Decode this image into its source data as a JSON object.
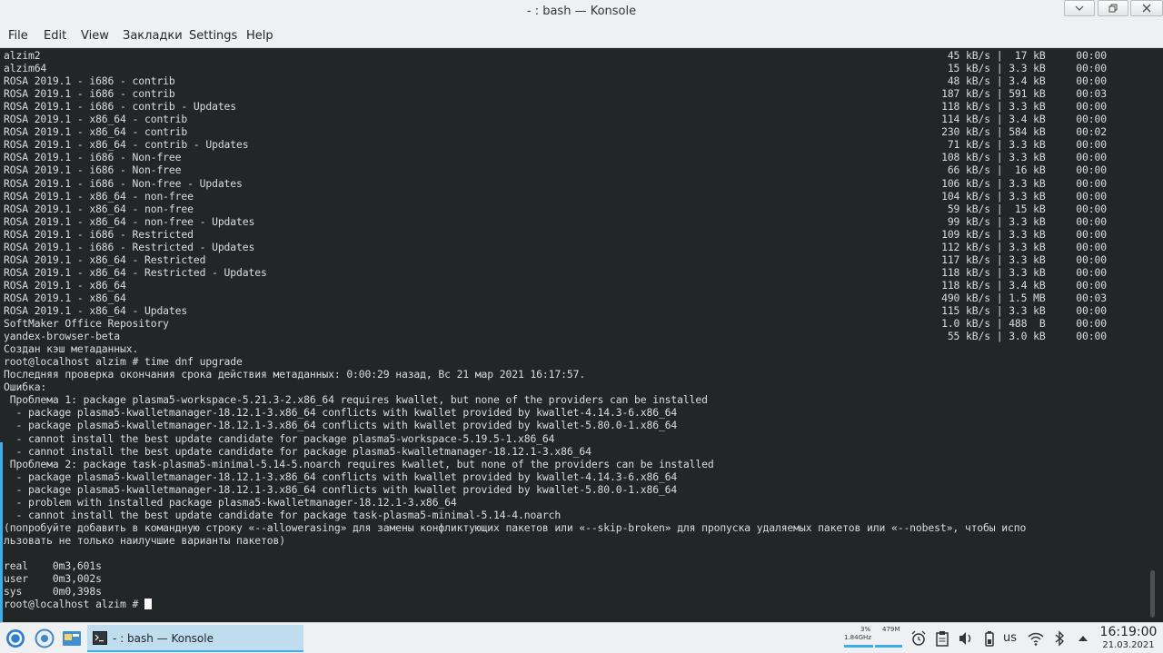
{
  "window": {
    "title": "- : bash — Konsole"
  },
  "menu": [
    "File",
    "Edit",
    "View",
    "Закладки",
    "Settings",
    "Help"
  ],
  "repo_lines": [
    {
      "name": "alzim2",
      "stats": "45 kB/s |  17 kB     00:00"
    },
    {
      "name": "alzim64",
      "stats": "15 kB/s | 3.3 kB     00:00"
    },
    {
      "name": "ROSA 2019.1 - i686 - contrib",
      "stats": "48 kB/s | 3.4 kB     00:00"
    },
    {
      "name": "ROSA 2019.1 - i686 - contrib",
      "stats": "187 kB/s | 591 kB     00:03"
    },
    {
      "name": "ROSA 2019.1 - i686 - contrib - Updates",
      "stats": "118 kB/s | 3.3 kB     00:00"
    },
    {
      "name": "ROSA 2019.1 - x86_64 - contrib",
      "stats": "114 kB/s | 3.4 kB     00:00"
    },
    {
      "name": "ROSA 2019.1 - x86_64 - contrib",
      "stats": "230 kB/s | 584 kB     00:02"
    },
    {
      "name": "ROSA 2019.1 - x86_64 - contrib - Updates",
      "stats": "71 kB/s | 3.3 kB     00:00"
    },
    {
      "name": "ROSA 2019.1 - i686 - Non-free",
      "stats": "108 kB/s | 3.3 kB     00:00"
    },
    {
      "name": "ROSA 2019.1 - i686 - Non-free",
      "stats": "66 kB/s |  16 kB     00:00"
    },
    {
      "name": "ROSA 2019.1 - i686 - Non-free - Updates",
      "stats": "106 kB/s | 3.3 kB     00:00"
    },
    {
      "name": "ROSA 2019.1 - x86_64 - non-free",
      "stats": "104 kB/s | 3.3 kB     00:00"
    },
    {
      "name": "ROSA 2019.1 - x86_64 - non-free",
      "stats": "59 kB/s |  15 kB     00:00"
    },
    {
      "name": "ROSA 2019.1 - x86_64 - non-free - Updates",
      "stats": "99 kB/s | 3.3 kB     00:00"
    },
    {
      "name": "ROSA 2019.1 - i686 - Restricted",
      "stats": "109 kB/s | 3.3 kB     00:00"
    },
    {
      "name": "ROSA 2019.1 - i686 - Restricted - Updates",
      "stats": "112 kB/s | 3.3 kB     00:00"
    },
    {
      "name": "ROSA 2019.1 - x86_64 - Restricted",
      "stats": "117 kB/s | 3.3 kB     00:00"
    },
    {
      "name": "ROSA 2019.1 - x86_64 - Restricted - Updates",
      "stats": "118 kB/s | 3.3 kB     00:00"
    },
    {
      "name": "ROSA 2019.1 - x86_64",
      "stats": "118 kB/s | 3.4 kB     00:00"
    },
    {
      "name": "ROSA 2019.1 - x86_64",
      "stats": "490 kB/s | 1.5 MB     00:03"
    },
    {
      "name": "ROSA 2019.1 - x86_64 - Updates",
      "stats": "115 kB/s | 3.3 kB     00:00"
    },
    {
      "name": "SoftMaker Office Repository",
      "stats": "1.0 kB/s | 488  B     00:00"
    },
    {
      "name": "yandex-browser-beta",
      "stats": "55 kB/s | 3.0 kB     00:00"
    }
  ],
  "output_lines": [
    "Создан кэш метаданных.",
    "root@localhost alzim # time dnf upgrade",
    "Последняя проверка окончания срока действия метаданных: 0:00:29 назад, Вс 21 мар 2021 16:17:57.",
    "Ошибка:",
    " Проблема 1: package plasma5-workspace-5.21.3-2.x86_64 requires kwallet, but none of the providers can be installed",
    "  - package plasma5-kwalletmanager-18.12.1-3.x86_64 conflicts with kwallet provided by kwallet-4.14.3-6.x86_64",
    "  - package plasma5-kwalletmanager-18.12.1-3.x86_64 conflicts with kwallet provided by kwallet-5.80.0-1.x86_64",
    "  - cannot install the best update candidate for package plasma5-workspace-5.19.5-1.x86_64",
    "  - cannot install the best update candidate for package plasma5-kwalletmanager-18.12.1-3.x86_64",
    " Проблема 2: package task-plasma5-minimal-5.14-5.noarch requires kwallet, but none of the providers can be installed",
    "  - package plasma5-kwalletmanager-18.12.1-3.x86_64 conflicts with kwallet provided by kwallet-4.14.3-6.x86_64",
    "  - package plasma5-kwalletmanager-18.12.1-3.x86_64 conflicts with kwallet provided by kwallet-5.80.0-1.x86_64",
    "  - problem with installed package plasma5-kwalletmanager-18.12.1-3.x86_64",
    "  - cannot install the best update candidate for package task-plasma5-minimal-5.14-4.noarch",
    "(попробуйте добавить в командную строку «--allowerasing» для замены конфликтующих пакетов или «--skip-broken» для пропуска удаляемых пакетов или «--nobest», чтобы испо",
    "льзовать не только наилучшие варианты пакетов)",
    "",
    "real    0m3,601s",
    "user    0m3,002s",
    "sys     0m0,398s",
    "root@localhost alzim # "
  ],
  "taskbar": {
    "task_label": "- : bash — Konsole",
    "cpu_percent": "3%",
    "cpu_freq": "1.84GHz",
    "mem": "479M",
    "lang": "us",
    "time": "16:19:00",
    "date": "21.03.2021"
  },
  "colors": {
    "terminal_bg": "#232627",
    "terminal_fg": "#dcdcdc",
    "accent": "#3daee9",
    "chrome_bg": "#eff0f1"
  }
}
